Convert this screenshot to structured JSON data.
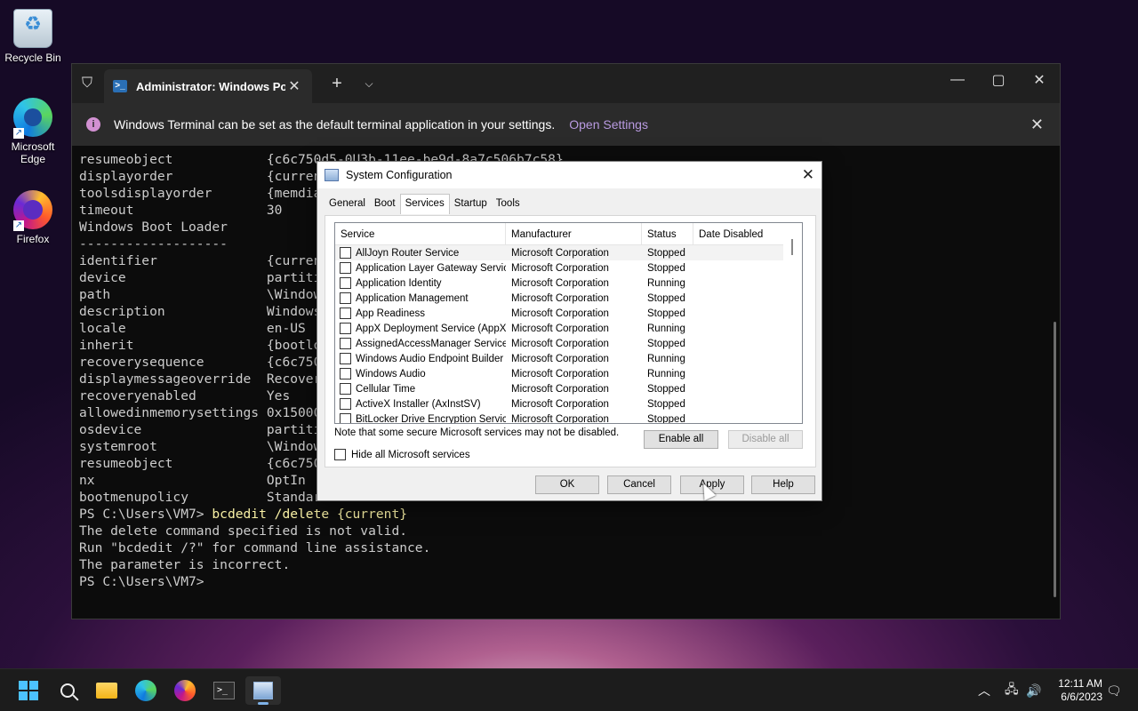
{
  "desktop": {
    "icons": [
      {
        "label": "Recycle Bin"
      },
      {
        "label": "Microsoft Edge"
      },
      {
        "label": "Firefox"
      }
    ]
  },
  "terminal": {
    "tab_title": "Administrator: Windows PowerShell",
    "infobar": {
      "message": "Windows Terminal can be set as the default terminal application in your settings.",
      "link": "Open Settings"
    },
    "lines": [
      "resumeobject            {c6c750d5-0U3b-11ee-be9d-8a7c506b7c58}",
      "displayorder            {current}",
      "toolsdisplayorder       {memdiag}",
      "timeout                 30",
      "",
      "Windows Boot Loader",
      "-------------------",
      "identifier              {current}",
      "device                  partition=C:",
      "path                    \\Windows\\system32\\winload.efi",
      "description             Windows 11",
      "locale                  en-US",
      "inherit                 {bootloadersettings}",
      "recoverysequence        {c6c750d5}",
      "displaymessageoverride  Recovery",
      "recoveryenabled         Yes",
      "allowedinmemorysettings 0x15000075",
      "osdevice                partition=C:",
      "systemroot              \\Windows",
      "resumeobject            {c6c750d5}",
      "nx                      OptIn",
      "bootmenupolicy          Standard"
    ],
    "prompt1": "PS C:\\Users\\VM7> ",
    "command": "bcdedit /delete {current}",
    "output": [
      "The delete command specified is not valid.",
      "Run \"bcdedit /?\" for command line assistance.",
      "The parameter is incorrect."
    ],
    "prompt2": "PS C:\\Users\\VM7>"
  },
  "dialog": {
    "title": "System Configuration",
    "tabs": [
      "General",
      "Boot",
      "Services",
      "Startup",
      "Tools"
    ],
    "active_tab": "Services",
    "columns": [
      "Service",
      "Manufacturer",
      "Status",
      "Date Disabled"
    ],
    "rows": [
      {
        "service": "AllJoyn Router Service",
        "manufacturer": "Microsoft Corporation",
        "status": "Stopped"
      },
      {
        "service": "Application Layer Gateway Service",
        "manufacturer": "Microsoft Corporation",
        "status": "Stopped"
      },
      {
        "service": "Application Identity",
        "manufacturer": "Microsoft Corporation",
        "status": "Running"
      },
      {
        "service": "Application Management",
        "manufacturer": "Microsoft Corporation",
        "status": "Stopped"
      },
      {
        "service": "App Readiness",
        "manufacturer": "Microsoft Corporation",
        "status": "Stopped"
      },
      {
        "service": "AppX Deployment Service (AppX...",
        "manufacturer": "Microsoft Corporation",
        "status": "Running"
      },
      {
        "service": "AssignedAccessManager Service",
        "manufacturer": "Microsoft Corporation",
        "status": "Stopped"
      },
      {
        "service": "Windows Audio Endpoint Builder",
        "manufacturer": "Microsoft Corporation",
        "status": "Running"
      },
      {
        "service": "Windows Audio",
        "manufacturer": "Microsoft Corporation",
        "status": "Running"
      },
      {
        "service": "Cellular Time",
        "manufacturer": "Microsoft Corporation",
        "status": "Stopped"
      },
      {
        "service": "ActiveX Installer (AxInstSV)",
        "manufacturer": "Microsoft Corporation",
        "status": "Stopped"
      },
      {
        "service": "BitLocker Drive Encryption Service",
        "manufacturer": "Microsoft Corporation",
        "status": "Stopped"
      }
    ],
    "note": "Note that some secure Microsoft services may not be disabled.",
    "enable_all": "Enable all",
    "disable_all": "Disable all",
    "hide_ms": "Hide all Microsoft services",
    "ok": "OK",
    "cancel": "Cancel",
    "apply": "Apply",
    "help": "Help"
  },
  "taskbar": {
    "time": "12:11 AM",
    "date": "6/6/2023"
  },
  "colors": {
    "accent": "#4cc2ff",
    "terminal_bg": "#0c0c0c",
    "command": "#f9f1a5",
    "link": "#b89ae0"
  }
}
